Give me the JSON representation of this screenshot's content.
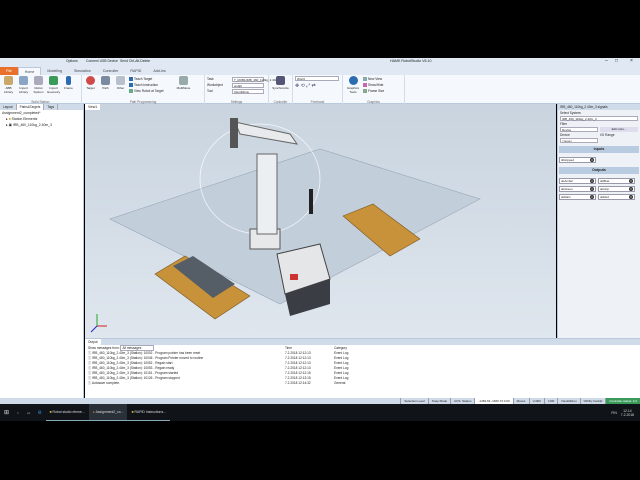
{
  "app": {
    "title": "HAMK RobotStudio V6.10",
    "quick": [
      "Options",
      "Connect USB Device",
      "Send Ctrl-Alt-Delete"
    ]
  },
  "tabs": [
    "File",
    "Home",
    "Modeling",
    "Simulation",
    "Controller",
    "RAPID",
    "Add-Ins"
  ],
  "ribbon": {
    "build_station": {
      "label": "Build Station",
      "buttons": [
        "ABB Library",
        "Import Library",
        "Robot System",
        "Import Geometry",
        "Frame"
      ]
    },
    "path_programming": {
      "label": "Path Programming",
      "buttons": [
        "Target",
        "Path",
        "Other",
        "MultiMove"
      ],
      "small": [
        "Teach Target",
        "Teach Instruction",
        "View Robot at Target"
      ]
    },
    "settings": {
      "label": "Settings",
      "rows": [
        {
          "label": "Task",
          "value": "T_ROB1(IRB_460_110kg_2.40m_3)"
        },
        {
          "label": "Workobject",
          "value": "wobj0"
        },
        {
          "label": "Tool",
          "value": "tVenttiiliimu"
        }
      ]
    },
    "controller": {
      "label": "Controller",
      "buttons": [
        "Synchronize"
      ]
    },
    "freehand": {
      "label": "Freehand",
      "value": "World"
    },
    "graphics": {
      "label": "Graphics",
      "buttons": [
        "Graphics Tools"
      ],
      "small": [
        "New View",
        "Show/Hide",
        "Frame Size"
      ]
    }
  },
  "left": {
    "tabs": [
      "Layout",
      "Paths&Targets",
      "Tags"
    ],
    "tree": [
      "Assignment2_completed*",
      "Station Elements",
      "IRB_460_110kg_2.40m_3"
    ]
  },
  "view": {
    "tab": "View1"
  },
  "right": {
    "title": "IRB_460_110kg_2.40m_3 signals",
    "select_system_label": "Select System:",
    "system": "IRB_460_110kg_2.40m_3",
    "filter_label": "Filter",
    "filter": "Device",
    "edit_list": "Edit Lists...",
    "device_label": "Device",
    "io_range_label": "I/O Range",
    "device": "<none>",
    "inputs_label": "Inputs",
    "inputs": [
      "diGripped"
    ],
    "outputs_label": "Outputs",
    "outputs": [
      "doAmber",
      "doBlue",
      "doGreen",
      "doGrip",
      "doRain",
      "doRed"
    ]
  },
  "output": {
    "tab": "Output",
    "filter_label": "Show messages from:",
    "filter": "All messages",
    "cols": [
      "",
      "Time",
      "Category"
    ],
    "rows": [
      {
        "m": "IRB_460_110kg_2.40m_3 (Station): 10002 - Program pointer has been reset",
        "t": "7.2.2018 12:12:13",
        "c": "Event Log"
      },
      {
        "m": "IRB_460_110kg_2.40m_3 (Station): 10045 - Program Pointer moved to routine",
        "t": "7.2.2018 12:12:13",
        "c": "Event Log"
      },
      {
        "m": "IRB_460_110kg_2.40m_3 (Station): 10052 - Regain start",
        "t": "7.2.2018 12:12:13",
        "c": "Event Log"
      },
      {
        "m": "IRB_460_110kg_2.40m_3 (Station): 10053 - Regain ready",
        "t": "7.2.2018 12:12:13",
        "c": "Event Log"
      },
      {
        "m": "IRB_460_110kg_2.40m_3 (Station): 10151 - Program started",
        "t": "7.2.2018 12:12:15",
        "c": "Event Log"
      },
      {
        "m": "IRB_460_110kg_2.40m_3 (Station): 10126 - Program stopped",
        "t": "7.2.2018 12:13:15",
        "c": "Event Log"
      },
      {
        "m": "Autosave complete.",
        "t": "7.2.2018 12:14:32",
        "c": "General"
      }
    ]
  },
  "status": {
    "items": [
      "Selection Level",
      "Snap Mode",
      "UCS: Station",
      "-1469.63   -1660.73   0.00",
      "MoveL",
      "*",
      "v1000",
      "z100",
      "tVenttiiliimu",
      "\\WObj:=wobj0"
    ],
    "controller": "Controller status: 1/1"
  },
  "taskbar": {
    "apps": [
      "Robot studio eleme...",
      "Assignment2_co...",
      "RAPID Instructions..."
    ],
    "lang": "FIN",
    "time": "12.14",
    "date": "7.2.2018"
  },
  "colors": {
    "file_tab": "#e8702a",
    "pallet": "#c8923a",
    "accent": "#2b6cb0"
  }
}
